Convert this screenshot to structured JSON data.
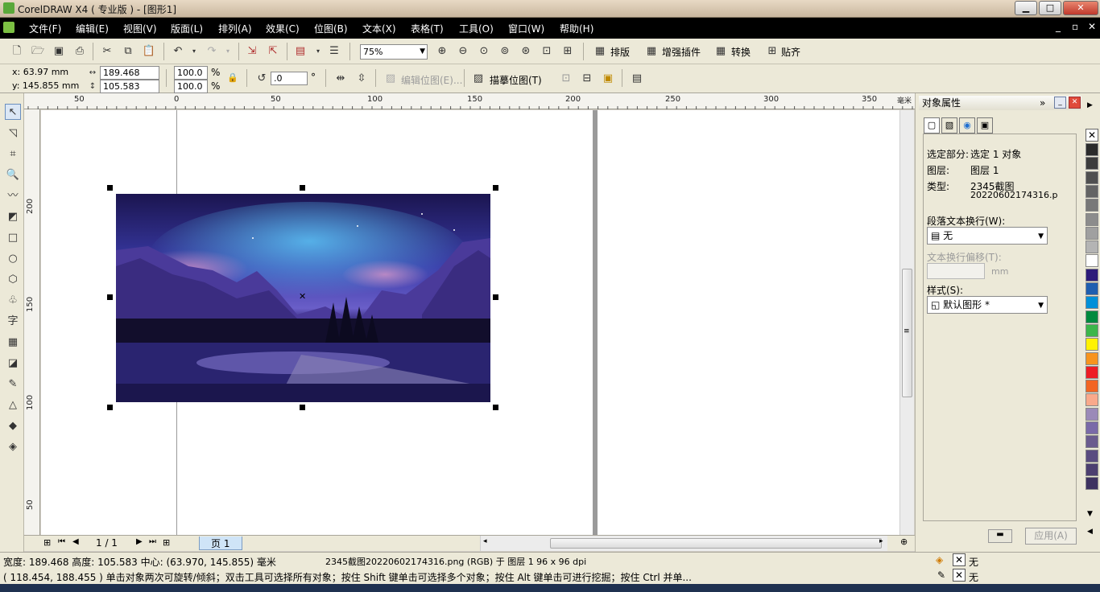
{
  "window": {
    "title": "CorelDRAW X4 ( 专业版 ) - [图形1]"
  },
  "menu": [
    "文件(F)",
    "编辑(E)",
    "视图(V)",
    "版面(L)",
    "排列(A)",
    "效果(C)",
    "位图(B)",
    "文本(X)",
    "表格(T)",
    "工具(O)",
    "窗口(W)",
    "帮助(H)"
  ],
  "toolbar": {
    "zoom_value": "75%",
    "custom_buttons": [
      "排版",
      "增强插件",
      "转换",
      "贴齐"
    ]
  },
  "property_bar": {
    "x": "x: 63.97 mm",
    "y": "y: 145.855 mm",
    "width": "189.468 mm",
    "height": "105.583 mm",
    "scale_w": "100.0",
    "scale_h": "100.0",
    "percent": "%",
    "rotation": ".0",
    "degree": "°",
    "edit_bitmap": "编辑位图(E)...",
    "trace_bitmap": "描摹位图(T)"
  },
  "ruler_top": [
    "50",
    "0",
    "50",
    "100",
    "150",
    "200",
    "250",
    "300",
    "350"
  ],
  "ruler_top_unit": "毫米",
  "ruler_left": [
    "200",
    "150",
    "100",
    "50"
  ],
  "page_nav": {
    "counter": "1 / 1",
    "tab": "页 1"
  },
  "docker": {
    "title": "对象属性",
    "selection_label": "选定部分:",
    "selection_value": "选定 1 对象",
    "layer_label": "图层:",
    "layer_value": "图层 1",
    "type_label": "类型:",
    "type_value_1": "2345截图",
    "type_value_2": "20220602174316.p",
    "wrap_label": "段落文本换行(W):",
    "wrap_value": "无",
    "offset_label": "文本换行偏移(T):",
    "offset_unit": "mm",
    "style_label": "样式(S):",
    "style_value": "默认图形 *",
    "apply_button": "应用(A)"
  },
  "palette_colors": [
    "#2b2b2b",
    "#3c3c3c",
    "#505050",
    "#646464",
    "#787878",
    "#8c8c8c",
    "#a0a0a0",
    "#b4b4b4",
    "#ffffff",
    "#2d1b7a",
    "#1f5fb0",
    "#0090d8",
    "#008a3e",
    "#3cb64a",
    "#fff200",
    "#f7941d",
    "#ed1c24",
    "#f26522",
    "#f9a98b",
    "#9b8ab8",
    "#7a6aa8",
    "#6a5b8e",
    "#5a4c80",
    "#4c3f70",
    "#3d3260"
  ],
  "status": {
    "line1_dims": "宽度: 189.468 高度: 105.583 中心: (63.970, 145.855) 毫米",
    "line1_object": "2345截图20220602174316.png (RGB) 于 图层 1 96 x 96 dpi",
    "line2": "( 118.454, 188.455 )    单击对象两次可旋转/倾斜；双击工具可选择所有对象；按住 Shift 键单击可选择多个对象；按住 Alt 键单击可进行挖掘；按住 Ctrl 并单...",
    "fill_label": "无",
    "outline_label": "无"
  }
}
